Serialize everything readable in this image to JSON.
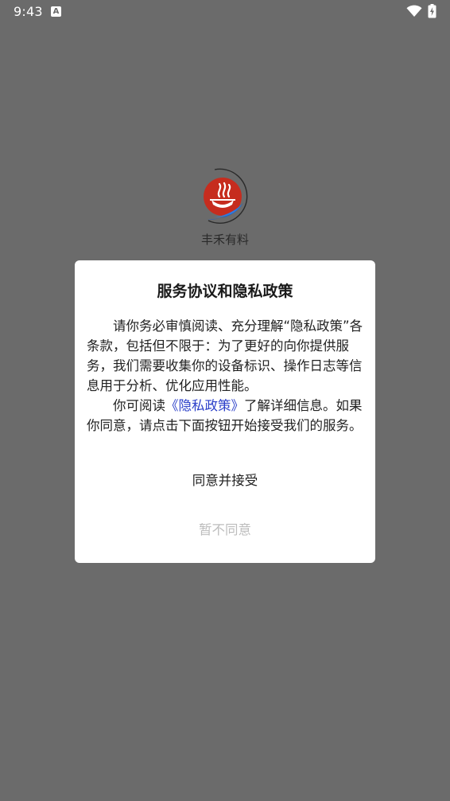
{
  "status_bar": {
    "time": "9:43",
    "notification_icon": "A",
    "icons": [
      "wifi-icon",
      "battery-charging-icon"
    ]
  },
  "splash": {
    "app_name": "丰禾有料",
    "logo_icon": "steaming-bowl-logo-icon"
  },
  "dialog": {
    "title": "服务协议和隐私政策",
    "paragraph1": "请你务必审慎阅读、充分理解“隐私政策”各条款，包括但不限于：为了更好的向你提供服务，我们需要收集你的设备标识、操作日志等信息用于分析、优化应用性能。",
    "paragraph2_prefix": "你可阅读",
    "policy_link": "《隐私政策》",
    "paragraph2_suffix": "了解详细信息。如果你同意，请点击下面按钮开始接受我们的服务。",
    "agree_label": "同意并接受",
    "disagree_label": "暂不同意"
  },
  "colors": {
    "overlay": "#6b6b6b",
    "link": "#2b3fc9",
    "disabled_text": "#bdbdbd",
    "logo_red": "#c62c1e",
    "logo_blue": "#1e5fc4"
  }
}
